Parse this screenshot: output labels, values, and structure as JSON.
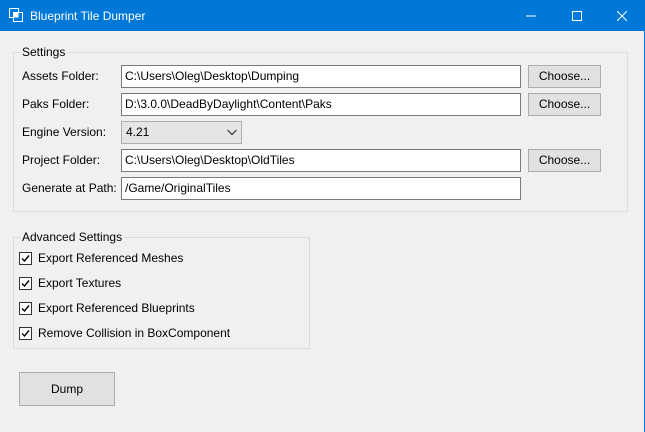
{
  "window": {
    "title": "Blueprint Tile Dumper",
    "accent": "#0078d7"
  },
  "settings": {
    "legend": "Settings",
    "assets_label": "Assets Folder:",
    "assets_value": "C:\\Users\\Oleg\\Desktop\\Dumping",
    "paks_label": "Paks Folder:",
    "paks_value": "D:\\3.0.0\\DeadByDaylight\\Content\\Paks",
    "engine_label": "Engine Version:",
    "engine_value": "4.21",
    "project_label": "Project Folder:",
    "project_value": "C:\\Users\\Oleg\\Desktop\\OldTiles",
    "generate_label": "Generate at Path:",
    "generate_value": "/Game/OriginalTiles",
    "choose_label": "Choose..."
  },
  "advanced": {
    "legend": "Advanced Settings",
    "options": [
      {
        "label": "Export Referenced Meshes",
        "checked": true
      },
      {
        "label": "Export Textures",
        "checked": true
      },
      {
        "label": "Export Referenced Blueprints",
        "checked": true
      },
      {
        "label": "Remove Collision in BoxComponent",
        "checked": true
      }
    ]
  },
  "actions": {
    "dump_label": "Dump"
  }
}
